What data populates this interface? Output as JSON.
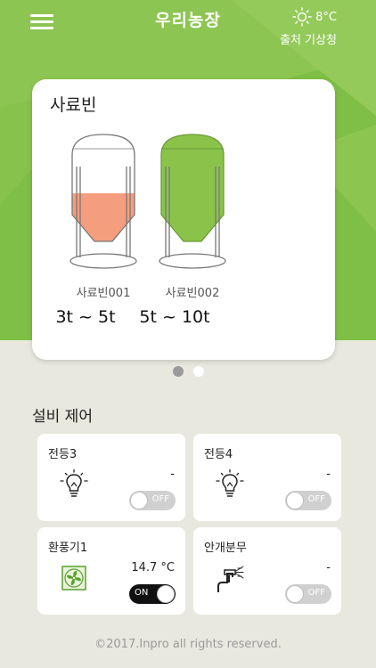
{
  "header": {
    "title": "우리농장",
    "menu_icon": "hamburger-menu-icon",
    "weather": {
      "icon": "sun-icon",
      "temperature": "8°C",
      "station": "출처 기상청"
    }
  },
  "silo_card": {
    "title": "사료빈",
    "silos": [
      {
        "name": "사료빈001",
        "range": "3t ~ 5t",
        "fill_fraction": 0.45,
        "fill_color": "#f59e7e"
      },
      {
        "name": "사료빈002",
        "range": "5t ~ 10t",
        "fill_fraction": 1.0,
        "fill_color": "#8bc34a"
      }
    ]
  },
  "pager": {
    "count": 2,
    "active_index": 0
  },
  "equipment": {
    "title": "설비 제어",
    "devices": [
      {
        "name": "전등3",
        "value": "-",
        "state": "OFF",
        "icon": "light-bulb-icon"
      },
      {
        "name": "전등4",
        "value": "-",
        "state": "OFF",
        "icon": "light-bulb-icon"
      },
      {
        "name": "환풍기1",
        "value": "14.7 °C",
        "state": "ON",
        "icon": "fan-icon"
      },
      {
        "name": "안개분무",
        "value": "-",
        "state": "OFF",
        "icon": "mist-sprayer-icon"
      }
    ]
  },
  "footer": {
    "text": "©2017.Inpro all rights reserved."
  },
  "colors": {
    "brand_green": "#7fbf45",
    "background": "#e8e8df",
    "silo_low": "#f59e7e",
    "silo_full": "#8bc34a"
  }
}
